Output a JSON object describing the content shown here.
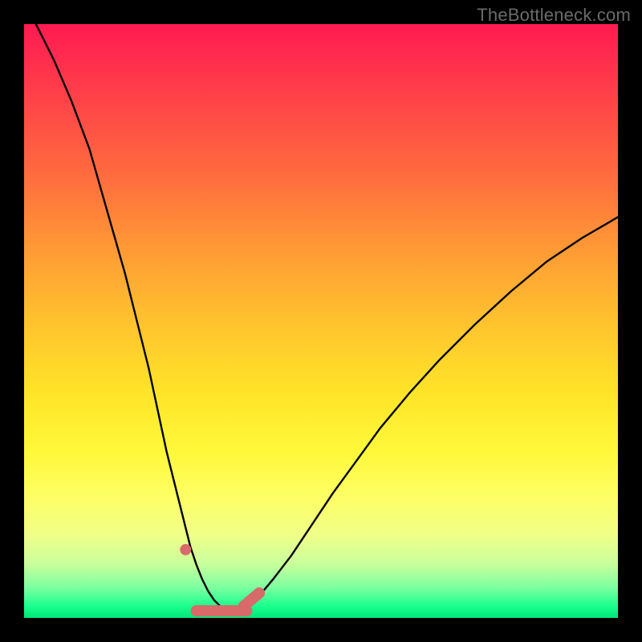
{
  "watermark": "TheBottleneck.com",
  "chart_data": {
    "type": "line",
    "title": "",
    "xlabel": "",
    "ylabel": "",
    "xlim": [
      0,
      100
    ],
    "ylim": [
      0,
      100
    ],
    "series": [
      {
        "name": "bottleneck-curve",
        "x": [
          2,
          5,
          8,
          11,
          13,
          15,
          17,
          19,
          21,
          22.5,
          24,
          25.5,
          27,
          28,
          29,
          30,
          31,
          32,
          33,
          34,
          35,
          36,
          38,
          40,
          42,
          45,
          48,
          52,
          56,
          60,
          65,
          70,
          76,
          82,
          88,
          94,
          100
        ],
        "y": [
          100,
          94,
          87,
          79,
          72,
          65,
          58,
          50,
          42,
          35,
          28,
          22,
          16,
          12,
          9,
          6.5,
          4.5,
          3,
          2,
          1.4,
          1.2,
          1.4,
          2.4,
          4.2,
          6.6,
          10.5,
          15,
          21,
          26.5,
          32,
          38,
          43.5,
          49.5,
          55,
          60,
          64,
          67.5
        ]
      }
    ],
    "annotations": {
      "optimal_floor_x": [
        29,
        37.5
      ],
      "optimal_floor_y": 1.2,
      "left_arm_dot": {
        "x": 27.2,
        "y": 11.5
      },
      "right_arm_segment": {
        "x0": 37.0,
        "y0": 2.0,
        "x1": 39.6,
        "y1": 4.2
      }
    }
  }
}
